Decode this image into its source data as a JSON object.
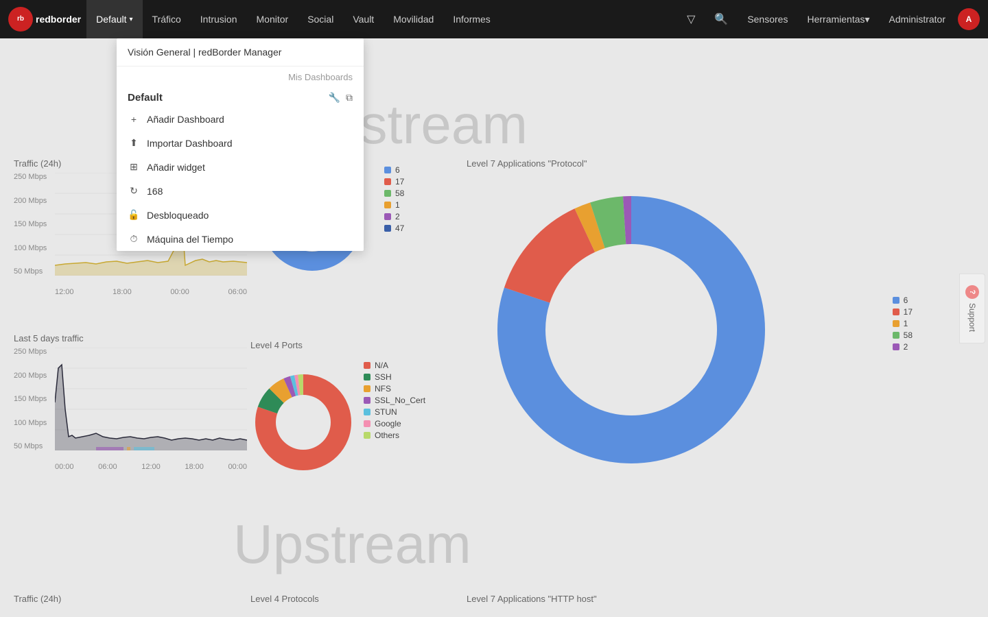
{
  "brand": {
    "logo_text": "rb",
    "name": "redborder"
  },
  "navbar": {
    "items": [
      {
        "label": "Default",
        "has_arrow": true,
        "active": true
      },
      {
        "label": "Tráfico"
      },
      {
        "label": "Intrusion"
      },
      {
        "label": "Monitor"
      },
      {
        "label": "Social"
      },
      {
        "label": "Vault"
      },
      {
        "label": "Movilidad"
      },
      {
        "label": "Informes"
      }
    ],
    "right_items": [
      {
        "label": "Sensores"
      },
      {
        "label": "Herramientas",
        "has_arrow": true
      },
      {
        "label": "Administrator"
      }
    ]
  },
  "dropdown": {
    "header": "Visión General | redBorder Manager",
    "section_label": "Mis Dashboards",
    "current_title": "Default",
    "items": [
      {
        "icon": "+",
        "label": "Añadir Dashboard"
      },
      {
        "icon": "⬆",
        "label": "Importar Dashboard"
      },
      {
        "icon": "⊞",
        "label": "Añadir widget"
      },
      {
        "icon": "↻",
        "label": "168"
      },
      {
        "icon": "🔓",
        "label": "Desbloqueado"
      },
      {
        "icon": "⏱",
        "label": "Máquina del Tiempo"
      }
    ]
  },
  "sections": {
    "downstream": "Downstream",
    "upstream": "Upstream"
  },
  "traffic_24h": {
    "title": "Traffic (24h)",
    "y_labels": [
      "250 Mbps",
      "200 Mbps",
      "150 Mbps",
      "100 Mbps",
      "50 Mbps"
    ],
    "x_labels": [
      "12:00",
      "18:00",
      "00:00",
      "06:00"
    ]
  },
  "last5_traffic": {
    "title": "Last 5 days traffic",
    "y_labels": [
      "250 Mbps",
      "200 Mbps",
      "150 Mbps",
      "100 Mbps",
      "50 Mbps"
    ],
    "x_labels": [
      "00:00",
      "06:00",
      "12:00",
      "18:00",
      "00:00"
    ]
  },
  "donut_small": {
    "legend": [
      {
        "color": "#5b8fde",
        "label": "6"
      },
      {
        "color": "#e05c4b",
        "label": "17"
      },
      {
        "color": "#6cb86a",
        "label": "58"
      },
      {
        "color": "#e8a030",
        "label": "1"
      },
      {
        "color": "#9b59b6",
        "label": "2"
      },
      {
        "color": "#3a5fa8",
        "label": "47"
      }
    ]
  },
  "level7_protocol": {
    "title": "Level 7 Applications \"Protocol\"",
    "legend": [
      {
        "color": "#5b8fde",
        "label": "6"
      },
      {
        "color": "#e05c4b",
        "label": "17"
      },
      {
        "color": "#e8a030",
        "label": "1"
      },
      {
        "color": "#6cb86a",
        "label": "58"
      },
      {
        "color": "#9b59b6",
        "label": "2"
      }
    ]
  },
  "level4_ports": {
    "title": "Level 4 Ports",
    "legend": [
      {
        "color": "#e05c4b",
        "label": "N/A"
      },
      {
        "color": "#2e8b57",
        "label": "SSH"
      },
      {
        "color": "#e8a030",
        "label": "NFS"
      },
      {
        "color": "#9b59b6",
        "label": "SSL_No_Cert"
      },
      {
        "color": "#5bc0de",
        "label": "STUN"
      },
      {
        "color": "#f48fb1",
        "label": "Google"
      },
      {
        "color": "#b8d96a",
        "label": "Others"
      }
    ]
  },
  "bottom_traffic": {
    "title": "Traffic (24h)"
  },
  "bottom_level4": {
    "title": "Level 4 Protocols"
  },
  "bottom_level7": {
    "title": "Level 7 Applications \"HTTP host\""
  },
  "support": {
    "label": "Support"
  }
}
